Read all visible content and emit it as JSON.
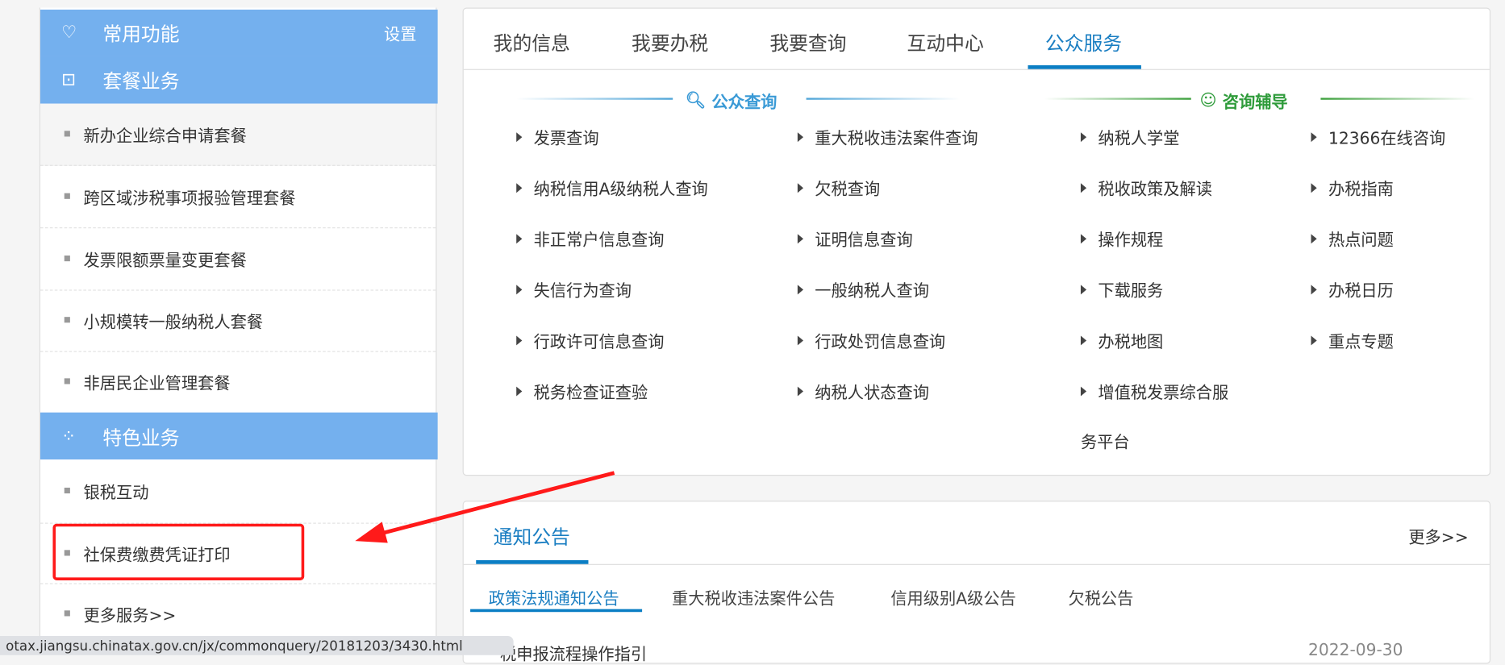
{
  "sidebar": {
    "common": {
      "title": "常用功能",
      "settings": "设置"
    },
    "package": {
      "title": "套餐业务",
      "items": [
        "新办企业综合申请套餐",
        "跨区域涉税事项报验管理套餐",
        "发票限额票量变更套餐",
        "小规模转一般纳税人套餐",
        "非居民企业管理套餐"
      ]
    },
    "special": {
      "title": "特色业务",
      "items": [
        "银税互动",
        "社保费缴费凭证打印",
        "更多服务>>"
      ]
    }
  },
  "main": {
    "tabs": [
      "我的信息",
      "我要办税",
      "我要查询",
      "互动中心",
      "公众服务"
    ],
    "active_tab": "公众服务",
    "public_query": {
      "title": "公众查询",
      "col1": [
        "发票查询",
        "纳税信用A级纳税人查询",
        "非正常户信息查询",
        "失信行为查询",
        "行政许可信息查询",
        "税务检查证查验"
      ],
      "col2": [
        "重大税收违法案件查询",
        "欠税查询",
        "证明信息查询",
        "一般纳税人查询",
        "行政处罚信息查询",
        "纳税人状态查询"
      ]
    },
    "consult": {
      "title": "咨询辅导",
      "col1": [
        "纳税人学堂",
        "税收政策及解读",
        "操作规程",
        "下载服务",
        "办税地图",
        "增值税发票综合服"
      ],
      "col1_wrap": "务平台",
      "col2": [
        "12366在线咨询",
        "办税指南",
        "热点问题",
        "办税日历",
        "重点专题"
      ]
    }
  },
  "notice": {
    "title": "通知公告",
    "more": "更多>>",
    "subtabs": [
      "政策法规通知公告",
      "重大税收违法案件公告",
      "信用级别A级公告",
      "欠税公告"
    ],
    "items": [
      {
        "title": "税申报流程操作指引",
        "date": "2022-09-30"
      }
    ]
  },
  "status_url": "otax.jiangsu.chinatax.gov.cn/jx/commonquery/20181203/3430.html",
  "colors": {
    "header": "#74b0ee",
    "accent": "#0b7ec4",
    "green": "#2e9b3a",
    "annotation": "#ff1a1a"
  }
}
